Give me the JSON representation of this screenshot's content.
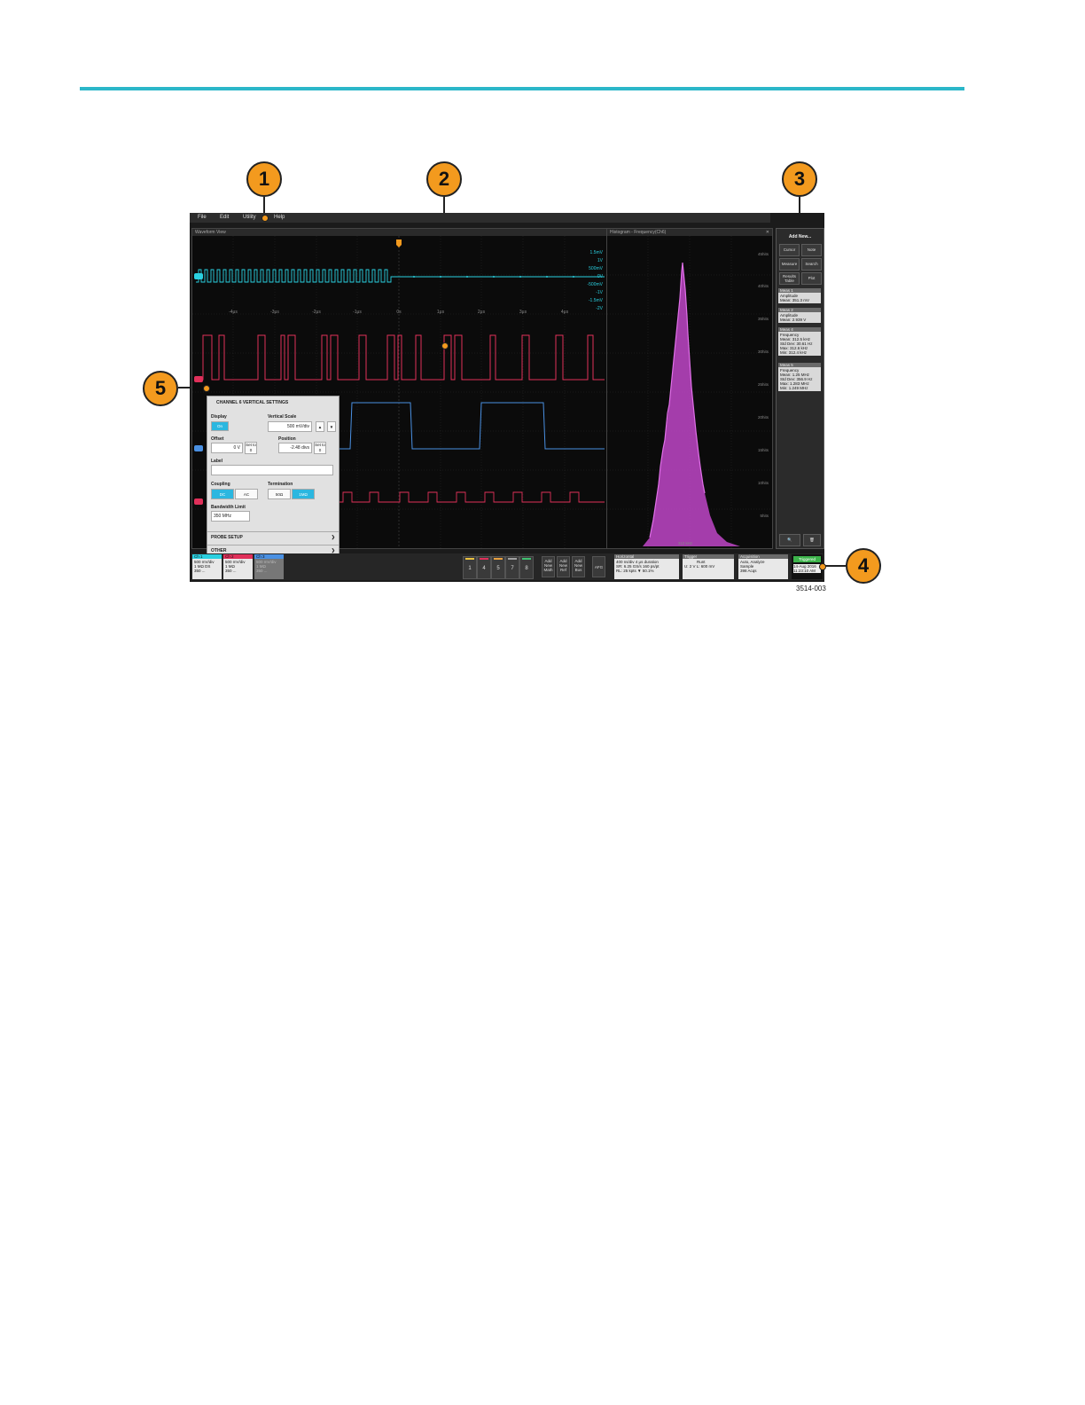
{
  "callouts": [
    "1",
    "2",
    "3",
    "4",
    "5"
  ],
  "menu": {
    "file": "File",
    "edit": "Edit",
    "utility": "Utility",
    "help": "Help"
  },
  "waveform_view": {
    "title": "Waveform View",
    "time_labels": [
      "-4μs",
      "-3μs",
      "-2μs",
      "-1μs",
      "0s",
      "1μs",
      "2μs",
      "3μs",
      "4μs"
    ],
    "scale_labels": [
      "1.5mV",
      "1V",
      "500mV",
      "0V",
      "-500mV",
      "-1V",
      "-1.5mV",
      "-2V"
    ]
  },
  "histogram": {
    "title": "Histogram - Frequency(Ch6)",
    "y_labels": [
      "45hits",
      "40hits",
      "35hits",
      "30hits",
      "25hits",
      "20hits",
      "15hits",
      "10hits",
      "5hits"
    ],
    "x_label": "312 kHz"
  },
  "right_panel": {
    "add_new": "Add New...",
    "cursor": "Cursor",
    "note": "Note",
    "measure": "Measure",
    "search": "Search",
    "results_table": "Results Table",
    "plot": "Plot",
    "meas": [
      {
        "name": "Meas 1",
        "lines": [
          "Amplitude",
          "Mean: 351.3 mV"
        ]
      },
      {
        "name": "Meas 2",
        "lines": [
          "Amplitude",
          "Mean: 2.939 V"
        ]
      },
      {
        "name": "Meas 4",
        "lines": [
          "Frequency",
          "Mean: 312.5 kHz",
          "Std Dev: 30.61 Hz",
          "Max: 312.6 kHz",
          "Min: 312.4 kHz"
        ]
      },
      {
        "name": "Meas 5",
        "lines": [
          "Frequency",
          "Mean: 1.25 MHz",
          "Std Dev: 356.9 Hz",
          "Max: 1.283 MHz",
          "Min: 1.249 MHz"
        ]
      }
    ]
  },
  "dialog": {
    "title": "CHANNEL 6 VERTICAL SETTINGS",
    "display_label": "Display",
    "display_on": "On",
    "vscale_label": "Vertical Scale",
    "vscale_value": "500 mV/div",
    "offset_label": "Offset",
    "offset_value": "0 V",
    "set_to_0": "Set to 0",
    "position_label": "Position",
    "position_value": "-2.48 divs",
    "label_label": "Label",
    "coupling_label": "Coupling",
    "dc": "DC",
    "ac": "AC",
    "termination_label": "Termination",
    "t50": "50Ω",
    "t1m": "1MΩ",
    "bw_label": "Bandwidth Limit",
    "bw_value": "350 MHz",
    "probe_setup": "PROBE SETUP",
    "other": "OTHER"
  },
  "bottom": {
    "channels": [
      {
        "name": "Ch 1",
        "lines": [
          "500 mV/div",
          "1 MΩ DS",
          "350 ..."
        ],
        "color": "#2ad0e0"
      },
      {
        "name": "Ch 2",
        "lines": [
          "500 mV/div",
          "1 MΩ",
          "350 ..."
        ],
        "color": "#e0305a"
      },
      {
        "name": "Ch 3",
        "lines": [
          "500 mV/div",
          "1 MΩ",
          "350 ..."
        ],
        "color": "#4a90e2"
      }
    ],
    "numbers": [
      "1",
      "4",
      "5",
      "7",
      "8"
    ],
    "add_math": "Add New Math",
    "add_ref": "Add New Ref",
    "add_bus": "Add New Bus",
    "afg": "AFG",
    "horizontal": {
      "title": "Horizontal",
      "lines": [
        "400 ns/div    4 μs duration",
        "SR: 6.25 GS/s  160 ps/pt",
        "RL: 25 kpts   ▼ 50.1%"
      ]
    },
    "trigger": {
      "title": "Trigger",
      "lines": [
        "Runt",
        "",
        "U: 2 V       L: 600 mV"
      ]
    },
    "acquisition": {
      "title": "Acquisition",
      "lines": [
        "Auto,      Analyze",
        "Sample",
        "398 Acqs"
      ]
    },
    "triggered": "Triggered",
    "date": "14-Aug 2016",
    "time": "11:23:10 AM"
  },
  "figure_id": "3514-003",
  "colors": {
    "ch1": "#2ad0e0",
    "ch2": "#e0305a",
    "ch3": "#4a90e2",
    "ch4": "#e0305a",
    "histogram": "#c046c8",
    "accent": "#2bb7c9",
    "callout": "#f39a1e"
  }
}
